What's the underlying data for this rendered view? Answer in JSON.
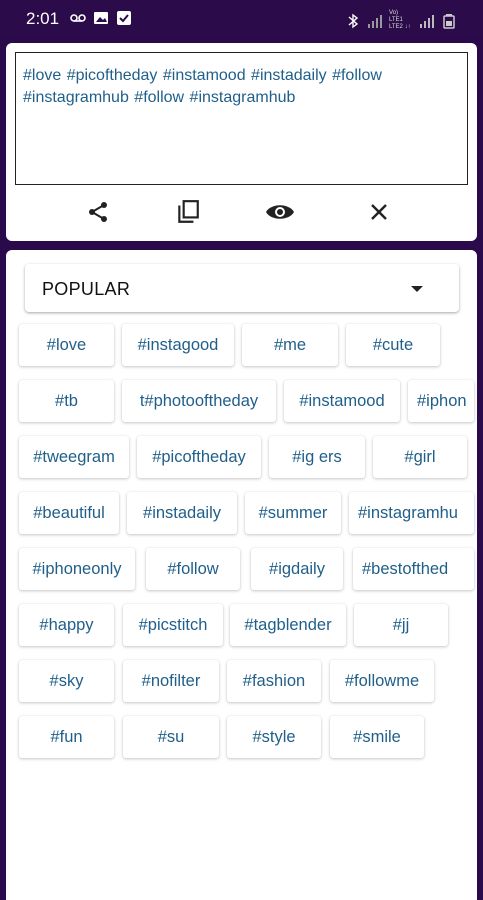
{
  "status": {
    "time": "2:01",
    "network": "Vo) LTE1\nLTE2 ↓↑"
  },
  "editor": {
    "text": "#love #picoftheday #instamood #instadaily #follow #instagramhub #follow #instagramhub"
  },
  "actions": [
    {
      "icon": "share-icon"
    },
    {
      "icon": "copy-icon"
    },
    {
      "icon": "eye-icon"
    },
    {
      "icon": "close-icon"
    }
  ],
  "category": {
    "selected": "POPULAR"
  },
  "tags": [
    [
      "#love",
      "#instagood",
      "#me",
      "#cute"
    ],
    [
      "#tb",
      "t#photooftheday",
      "#instamood",
      "#iphon"
    ],
    [
      "#tweegram",
      "#picoftheday",
      "#ig  ers",
      "#girl"
    ],
    [
      "#beautiful",
      "#instadaily",
      "#summer",
      "#instagramhu"
    ],
    [
      "#iphoneonly",
      "#follow",
      "#igdaily",
      "#bestofthed"
    ],
    [
      "#happy",
      "#picstitch",
      "#tagblender",
      "#jj"
    ],
    [
      "#sky",
      "#nofilter",
      "#fashion",
      "#followme"
    ],
    [
      "#fun",
      "#su",
      "#style",
      "#smile"
    ]
  ]
}
